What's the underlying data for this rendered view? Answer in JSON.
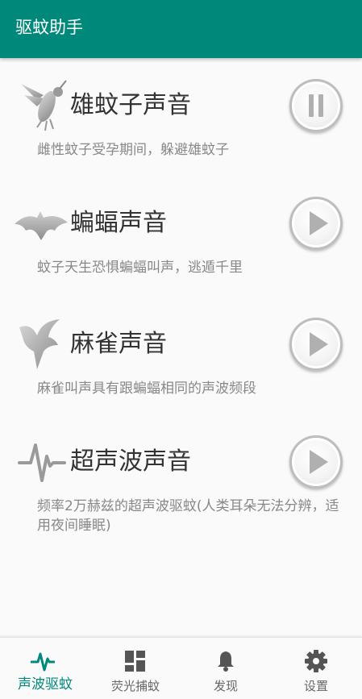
{
  "app": {
    "title": "驱蚊助手",
    "accent_color": "#00897b"
  },
  "sounds": [
    {
      "title": "雄蚊子声音",
      "description": "雌性蚊子受孕期间，躲避雄蚊子",
      "icon": "mosquito-icon",
      "state": "pause"
    },
    {
      "title": "蝙蝠声音",
      "description": "蚊子天生恐惧蝙蝠叫声，逃遁千里",
      "icon": "bat-icon",
      "state": "play"
    },
    {
      "title": "麻雀声音",
      "description": "麻雀叫声具有跟蝙蝠相同的声波频段",
      "icon": "sparrow-icon",
      "state": "play"
    },
    {
      "title": "超声波声音",
      "description": "频率2万赫兹的超声波驱蚊(人类耳朵无法分辨，适用夜间睡眠)",
      "icon": "waveform-icon",
      "state": "play"
    }
  ],
  "bottom_nav": [
    {
      "label": "声波驱蚊",
      "icon": "pulse-icon",
      "active": true
    },
    {
      "label": "荧光捕蚊",
      "icon": "dashboard-icon",
      "active": false
    },
    {
      "label": "发现",
      "icon": "bell-icon",
      "active": false
    },
    {
      "label": "设置",
      "icon": "gear-icon",
      "active": false
    }
  ]
}
